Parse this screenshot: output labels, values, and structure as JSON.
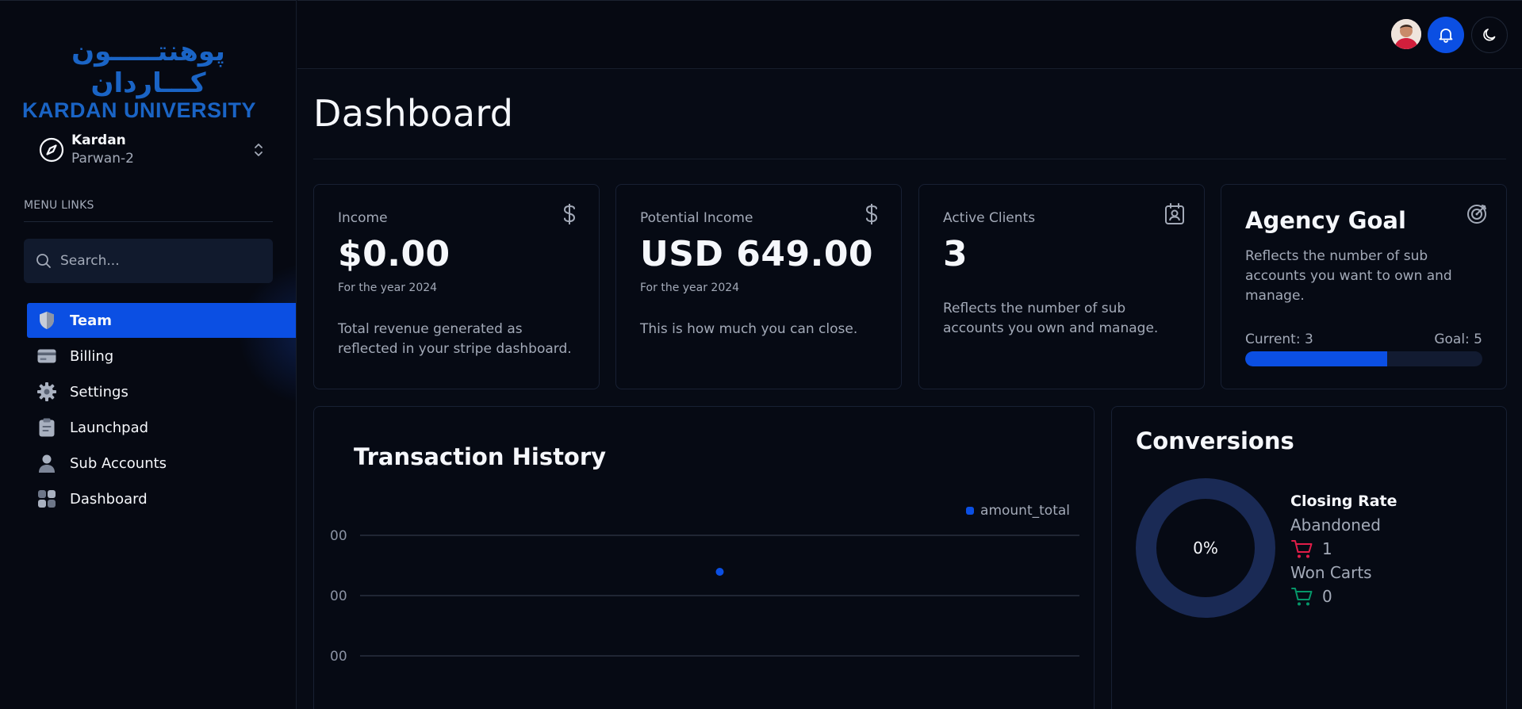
{
  "brand": {
    "logo_arabic": "پوهنتـــــون کـــاردان",
    "logo_latin": "KARDAN UNIVERSITY"
  },
  "org": {
    "name": "Kardan",
    "branch": "Parwan-2"
  },
  "sidebar": {
    "menu_label": "MENU LINKS",
    "search_placeholder": "Search...",
    "items": [
      {
        "label": "Team",
        "icon": "shield-icon",
        "active": true
      },
      {
        "label": "Billing",
        "icon": "credit-card-icon"
      },
      {
        "label": "Settings",
        "icon": "gear-icon"
      },
      {
        "label": "Launchpad",
        "icon": "clipboard-icon"
      },
      {
        "label": "Sub Accounts",
        "icon": "user-icon"
      },
      {
        "label": "Dashboard",
        "icon": "grid-icon"
      }
    ]
  },
  "page": {
    "title": "Dashboard"
  },
  "cards": {
    "income": {
      "label": "Income",
      "value": "$0.00",
      "sub": "For the year 2024",
      "desc": "Total revenue generated as reflected in your stripe dashboard.",
      "icon": "dollar-icon"
    },
    "potential": {
      "label": "Potential Income",
      "value": "USD 649.00",
      "sub": "For the year 2024",
      "desc": "This is how much you can close.",
      "icon": "dollar-icon"
    },
    "clients": {
      "label": "Active Clients",
      "value": "3",
      "desc": "Reflects the number of sub accounts you own and manage.",
      "icon": "contact-icon"
    },
    "goal": {
      "title": "Agency Goal",
      "desc": "Reflects the number of sub accounts you want to own and manage.",
      "current_label": "Current: 3",
      "goal_label": "Goal: 5",
      "progress": 0.6,
      "icon": "goal-icon"
    }
  },
  "transactions": {
    "title": "Transaction History",
    "legend": "amount_total"
  },
  "conversions": {
    "title": "Conversions",
    "rate": "0%",
    "closing_rate_label": "Closing Rate",
    "abandoned_label": "Abandoned",
    "abandoned_count": "1",
    "won_label": "Won Carts",
    "won_count": "0"
  },
  "colors": {
    "accent": "#0b4fe3",
    "abandoned": "#e11d48",
    "won": "#059669",
    "donut_track": "#1a2a55"
  },
  "chart_data": {
    "type": "line",
    "series": [
      {
        "name": "amount_total",
        "x": [
          0.5
        ],
        "y": [
          0.5
        ]
      }
    ],
    "ytick_labels": [
      "00",
      "00",
      "00"
    ],
    "legend": "top-right",
    "grid": true
  }
}
